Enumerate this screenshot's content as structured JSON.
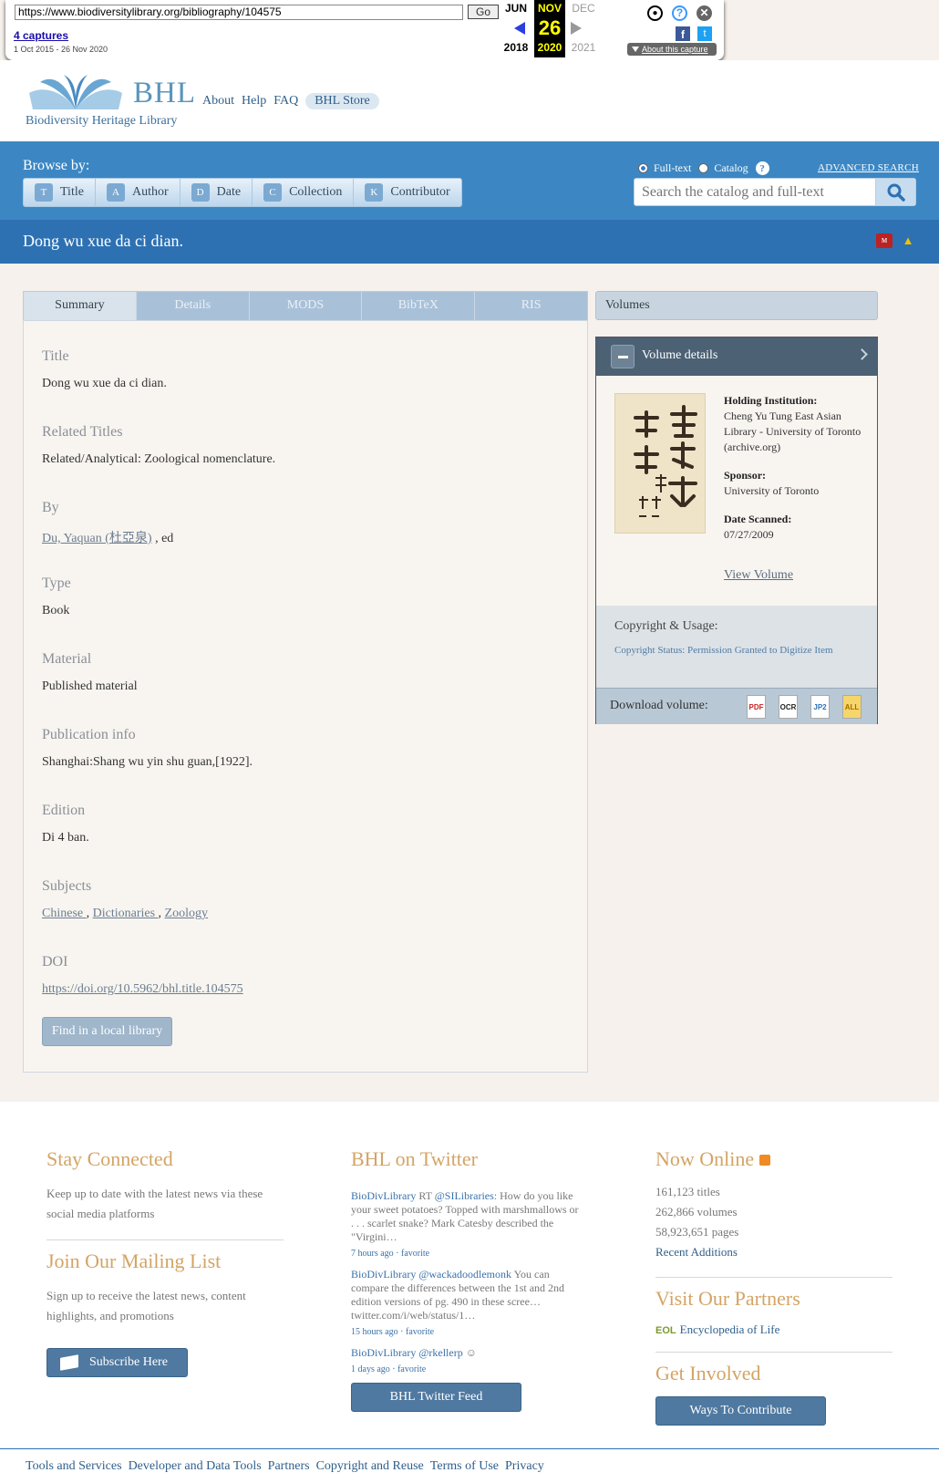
{
  "wayback": {
    "url": "https://www.biodiversitylibrary.org/bibliography/104575",
    "go_label": "Go",
    "captures": "4 captures",
    "range": "1 Oct 2015 - 26 Nov 2020",
    "prev_month": "JUN",
    "prev_year": "2018",
    "cur_month": "NOV",
    "cur_day": "26",
    "cur_year": "2020",
    "next_month": "DEC",
    "next_year": "2021",
    "about": "About this capture"
  },
  "header": {
    "logo_text": "BHL",
    "logo_sub": "Biodiversity Heritage Library",
    "nav": [
      "About",
      "Help",
      "FAQ"
    ],
    "store": "BHL Store"
  },
  "browse": {
    "label": "Browse by:",
    "buttons": [
      {
        "label": "Title",
        "icon": "T"
      },
      {
        "label": "Author",
        "icon": "A"
      },
      {
        "label": "Date",
        "icon": "D"
      },
      {
        "label": "Collection",
        "icon": "C"
      },
      {
        "label": "Contributor",
        "icon": "K"
      }
    ]
  },
  "search": {
    "fulltext": "Full-text",
    "catalog": "Catalog",
    "advanced": "ADVANCED SEARCH",
    "placeholder": "Search the catalog and full-text"
  },
  "title_bar": {
    "title": "Dong wu xue da ci dian."
  },
  "tabs": [
    "Summary",
    "Details",
    "MODS",
    "BibTeX",
    "RIS"
  ],
  "summary": {
    "title_h": "Title",
    "title_v": "Dong wu xue da ci dian.",
    "related_h": "Related Titles",
    "related_v": "Related/Analytical: Zoological nomenclature.",
    "by_h": "By",
    "by_link": "Du, Yaquan (杜亞泉)",
    "by_suffix": " , ed",
    "type_h": "Type",
    "type_v": "Book",
    "material_h": "Material",
    "material_v": "Published material",
    "pub_h": "Publication info",
    "pub_v": "Shanghai:Shang wu yin shu guan,[1922].",
    "edition_h": "Edition",
    "edition_v": "Di 4 ban.",
    "subjects_h": "Subjects",
    "subjects": [
      "Chinese",
      "Dictionaries",
      "Zoology"
    ],
    "doi_h": "DOI",
    "doi_v": "https://doi.org/10.5962/bhl.title.104575",
    "find_button": "Find in a local library"
  },
  "volumes": {
    "tab": "Volumes",
    "header": "Volume details",
    "holding_label": "Holding Institution:",
    "holding_value": "Cheng Yu Tung East Asian Library - University of Toronto (archive.org)",
    "sponsor_label": "Sponsor:",
    "sponsor_value": "University of Toronto",
    "scanned_label": "Date Scanned:",
    "scanned_value": "07/27/2009",
    "view_volume": "View Volume",
    "copyright_h": "Copyright & Usage:",
    "copyright_status": "Copyright Status: Permission Granted to Digitize Item",
    "download_label": "Download volume:",
    "downloads": [
      "PDF",
      "OCR",
      "JP2",
      "ALL"
    ]
  },
  "footer": {
    "stay_h": "Stay Connected",
    "stay_t": "Keep up to date with the latest news via these social media platforms",
    "mail_h": "Join Our Mailing List",
    "mail_t": "Sign up to receive the latest news, content highlights, and promotions",
    "subscribe": "Subscribe Here",
    "twitter_h": "BHL on Twitter",
    "tweets": [
      {
        "user": "BioDivLibrary",
        "mid": " RT ",
        "mention": "@SILibraries",
        "text": ": How do you like your sweet potatoes? Topped with marshmallows or . . . scarlet snake? Mark Catesby described the \"Virgini…",
        "meta": "7 hours ago · favorite"
      },
      {
        "user": "BioDivLibrary",
        "mid": " ",
        "mention": "@wackadoodlemonk",
        "text": " You can compare the differences between the 1st and 2nd edition versions of pg. 490 in these scree… twitter.com/i/web/status/1…",
        "meta": "15 hours ago · favorite"
      },
      {
        "user": "BioDivLibrary",
        "mid": " ",
        "mention": "@rkellerp",
        "text": " ☺",
        "meta": "1 days ago · favorite"
      }
    ],
    "twitter_feed": "BHL Twitter Feed",
    "online_h": "Now Online",
    "stats": [
      "161,123 titles",
      "262,866 volumes",
      "58,923,651 pages"
    ],
    "recent": "Recent Additions",
    "partners_h": "Visit Our Partners",
    "eol_logo": "EOL",
    "eol": "Encyclopedia of Life",
    "involved_h": "Get Involved",
    "contribute": "Ways To Contribute"
  },
  "bottom_links": [
    "Tools and Services",
    "Developer and Data Tools",
    "Partners",
    "Copyright and Reuse",
    "Terms of Use",
    "Privacy"
  ]
}
